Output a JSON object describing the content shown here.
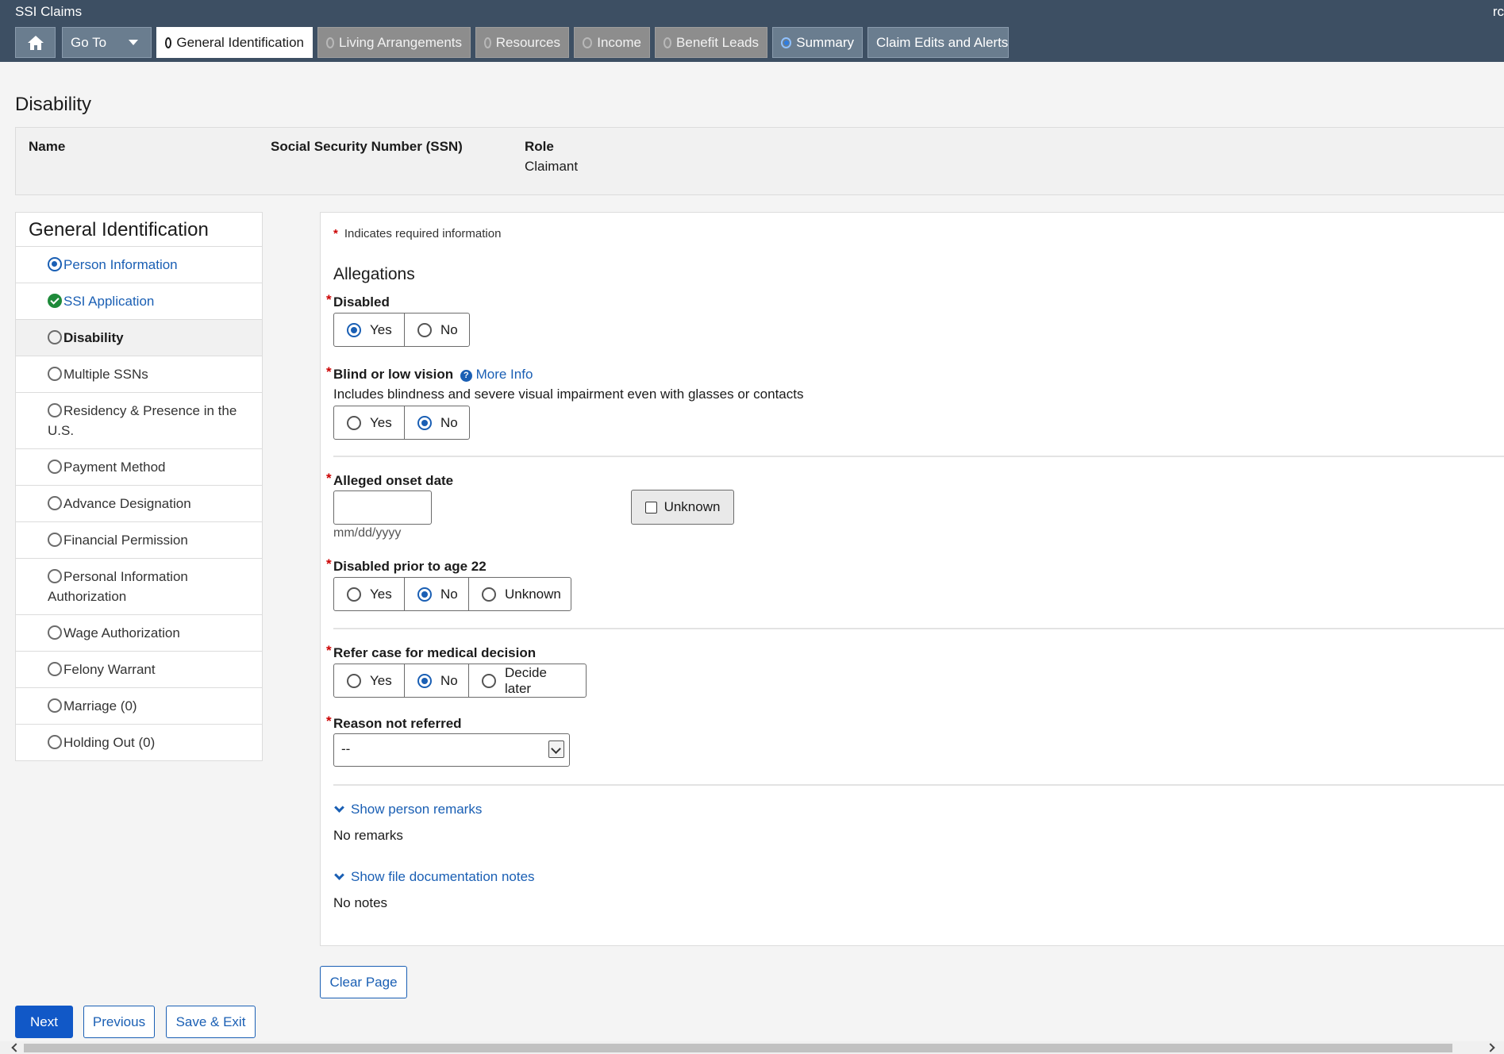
{
  "app": {
    "title": "SSI Claims",
    "user_abbrev": "rc"
  },
  "nav": {
    "home_icon": "home-icon",
    "goto_label": "Go To",
    "tabs": [
      {
        "label": "General Identification",
        "state": "active"
      },
      {
        "label": "Living Arrangements",
        "state": "disabled"
      },
      {
        "label": "Resources",
        "state": "disabled"
      },
      {
        "label": "Income",
        "state": "disabled"
      },
      {
        "label": "Benefit Leads",
        "state": "disabled"
      },
      {
        "label": "Summary",
        "state": "selected"
      },
      {
        "label": "Claim Edits and Alerts",
        "state": "plain"
      }
    ]
  },
  "page": {
    "title": "Disability"
  },
  "person": {
    "name_label": "Name",
    "ssn_label": "Social Security Number (SSN)",
    "role_label": "Role",
    "role_value": "Claimant"
  },
  "sidebar": {
    "title": "General Identification",
    "items": [
      {
        "label": "Person Information",
        "status": "selected-link"
      },
      {
        "label": "SSI Application",
        "status": "complete-link"
      },
      {
        "label": "Disability",
        "status": "current"
      },
      {
        "label": "Multiple SSNs",
        "status": "empty"
      },
      {
        "label": "Residency & Presence in the U.S.",
        "status": "empty"
      },
      {
        "label": "Payment Method",
        "status": "empty"
      },
      {
        "label": "Advance Designation",
        "status": "empty"
      },
      {
        "label": "Financial Permission",
        "status": "empty"
      },
      {
        "label": "Personal Information Authorization",
        "status": "empty"
      },
      {
        "label": "Wage Authorization",
        "status": "empty"
      },
      {
        "label": "Felony Warrant",
        "status": "empty"
      },
      {
        "label": "Marriage (0)",
        "status": "empty"
      },
      {
        "label": "Holding Out (0)",
        "status": "empty"
      }
    ]
  },
  "form": {
    "required_star": "*",
    "required_note": "Indicates required information",
    "section_title": "Allegations",
    "disabled": {
      "label": "Disabled",
      "options": [
        "Yes",
        "No"
      ],
      "selected": "Yes"
    },
    "blind": {
      "label": "Blind or low vision",
      "more_info": "More Info",
      "help_icon": "?",
      "help": "Includes blindness and severe visual impairment even with glasses or contacts",
      "options": [
        "Yes",
        "No"
      ],
      "selected": "No"
    },
    "onset": {
      "label": "Alleged onset date",
      "value": "",
      "hint": "mm/dd/yyyy",
      "unknown_label": "Unknown",
      "unknown_checked": false
    },
    "prior22": {
      "label": "Disabled prior to age 22",
      "options": [
        "Yes",
        "No",
        "Unknown"
      ],
      "selected": "No"
    },
    "refer": {
      "label": "Refer case for medical decision",
      "options": [
        "Yes",
        "No",
        "Decide later"
      ],
      "selected": "No"
    },
    "reason": {
      "label": "Reason not referred",
      "selected": "--"
    },
    "remarks": {
      "toggle": "Show person remarks",
      "text": "No remarks"
    },
    "notes": {
      "toggle": "Show file documentation notes",
      "text": "No notes"
    }
  },
  "actions": {
    "clear": "Clear Page",
    "next": "Next",
    "previous": "Previous",
    "save_exit": "Save & Exit"
  },
  "colors": {
    "header_bg": "#3d4f63",
    "link": "#1a5fb4",
    "primary_button": "#1158c7",
    "required": "#cc0000",
    "complete": "#1e8a3a"
  }
}
